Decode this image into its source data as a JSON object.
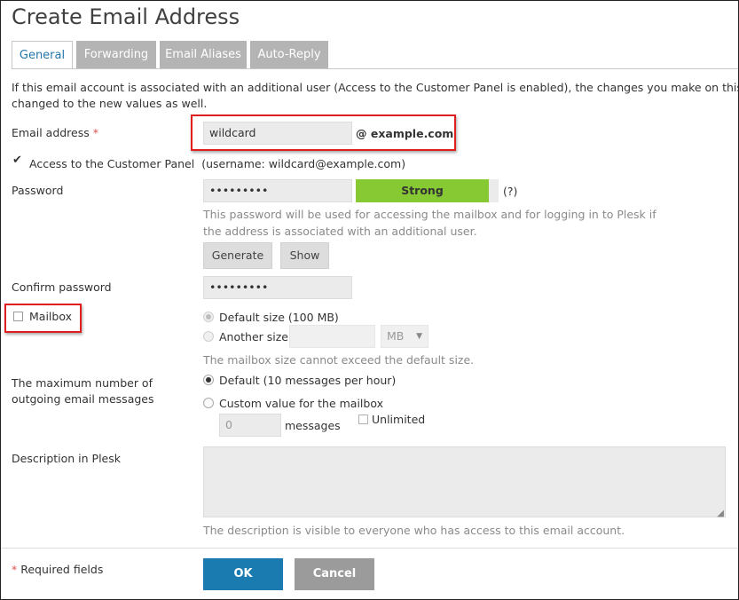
{
  "page": {
    "title": "Create Email Address"
  },
  "tabs": [
    {
      "label": "General",
      "active": true
    },
    {
      "label": "Forwarding",
      "active": false
    },
    {
      "label": "Email Aliases",
      "active": false
    },
    {
      "label": "Auto-Reply",
      "active": false
    }
  ],
  "intro": {
    "line1": "If this email account is associated with an additional user (Access to the Customer Panel is enabled), the changes you make on this page",
    "line2": "changed to the new values as well."
  },
  "email": {
    "label": "Email address",
    "required_mark": "*",
    "value": "wildcard",
    "domain": "@ example.com"
  },
  "customer_panel": {
    "label": "Access to the Customer Panel",
    "note": "(username: wildcard@example.com)",
    "checked": true
  },
  "password": {
    "label": "Password",
    "value": "•••••••••",
    "strength": "Strong",
    "strength_color": "#86c933",
    "help": "(?)",
    "hint_line1": "This password will be used for accessing the mailbox and for logging in to Plesk if",
    "hint_line2": "the address is associated with an additional user.",
    "generate_label": "Generate",
    "show_label": "Show"
  },
  "confirm_password": {
    "label": "Confirm password",
    "value": "•••••••••"
  },
  "mailbox": {
    "label": "Mailbox",
    "checked": false,
    "default_size_label": "Default size (100 MB)",
    "another_size_label": "Another size",
    "another_size_value": "",
    "unit": "MB",
    "hint": "The mailbox size cannot exceed the default size."
  },
  "outgoing": {
    "label_line1": "The maximum number of",
    "label_line2": "outgoing email messages",
    "default_label": "Default (10 messages per hour)",
    "custom_label": "Custom value for the mailbox",
    "custom_value": "0",
    "messages_label": "messages",
    "unlimited_label": "Unlimited"
  },
  "description": {
    "label": "Description in Plesk",
    "value": "",
    "hint": "The description is visible to everyone who has access to this email account."
  },
  "footer": {
    "required_mark": "*",
    "required_text": "Required fields",
    "ok_label": "OK",
    "cancel_label": "Cancel"
  },
  "colors": {
    "accent": "#1a7bb0",
    "highlight": "#e01e1e",
    "strength": "#86c933",
    "tab_inactive": "#b4b4b4"
  }
}
